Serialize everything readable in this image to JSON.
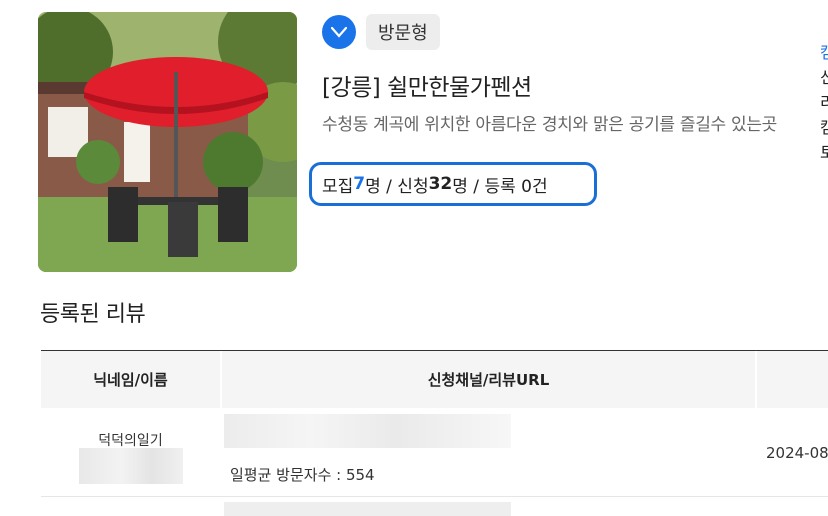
{
  "campaign": {
    "check_icon": "check-circle-icon",
    "type": "방문형",
    "title": "[강릉] 쉴만한물가펜션",
    "description": "수청동 계곡에 위치한 아름다운 경치와 맑은 공기를 즐길수 있는곳",
    "stats": {
      "recruit_label": "모집 ",
      "recruit_count": "7",
      "recruit_unit": "명 / 신청 ",
      "apply_count": "32",
      "apply_unit": "명 / 등록 0건"
    },
    "accent_color": "#1a73e8"
  },
  "edge_text": [
    "캠",
    "신",
    "리",
    "캠",
    "토"
  ],
  "reviews": {
    "section_title": "등록된 리뷰",
    "headers": [
      "닉네임/이름",
      "신청채널/리뷰URL",
      ""
    ],
    "rows": [
      {
        "nickname": "덕덕의일기",
        "visits": "일평균 방문자수 : 554",
        "date": "2024-08"
      }
    ]
  }
}
